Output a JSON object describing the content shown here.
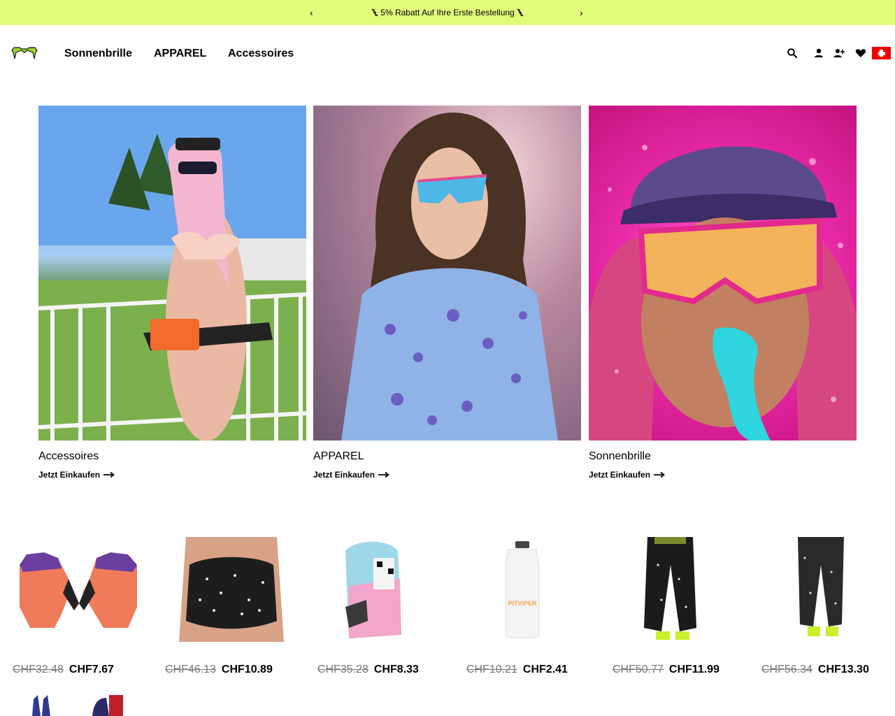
{
  "announcement": {
    "message": "5% Rabatt Auf Ihre Erste Bestellung",
    "prev_icon": "‹",
    "next_icon": "›"
  },
  "header": {
    "logo": "brand-logo",
    "nav": [
      "Sonnenbrille",
      "APPAREL",
      "Accessoires"
    ],
    "icons": [
      "search-icon",
      "account-icon",
      "register-icon",
      "wishlist-icon",
      "swiss-flag-icon"
    ]
  },
  "categories": [
    {
      "title": "Accessoires",
      "cta": "Jetzt Einkaufen"
    },
    {
      "title": "APPAREL",
      "cta": "Jetzt Einkaufen"
    },
    {
      "title": "Sonnenbrille",
      "cta": "Jetzt Einkaufen"
    }
  ],
  "products": [
    {
      "old_price": "CHF32.48",
      "new_price": "CHF7.67"
    },
    {
      "old_price": "CHF46.13",
      "new_price": "CHF10.89"
    },
    {
      "old_price": "CHF35.28",
      "new_price": "CHF8.33"
    },
    {
      "old_price": "CHF10.21",
      "new_price": "CHF2.41"
    },
    {
      "old_price": "CHF50.77",
      "new_price": "CHF11.99"
    },
    {
      "old_price": "CHF56.34",
      "new_price": "CHF13.30"
    }
  ],
  "colors": {
    "announcement_bg": "#e0fd7a",
    "logo_green": "#9ad42a",
    "old_price": "#777777"
  }
}
